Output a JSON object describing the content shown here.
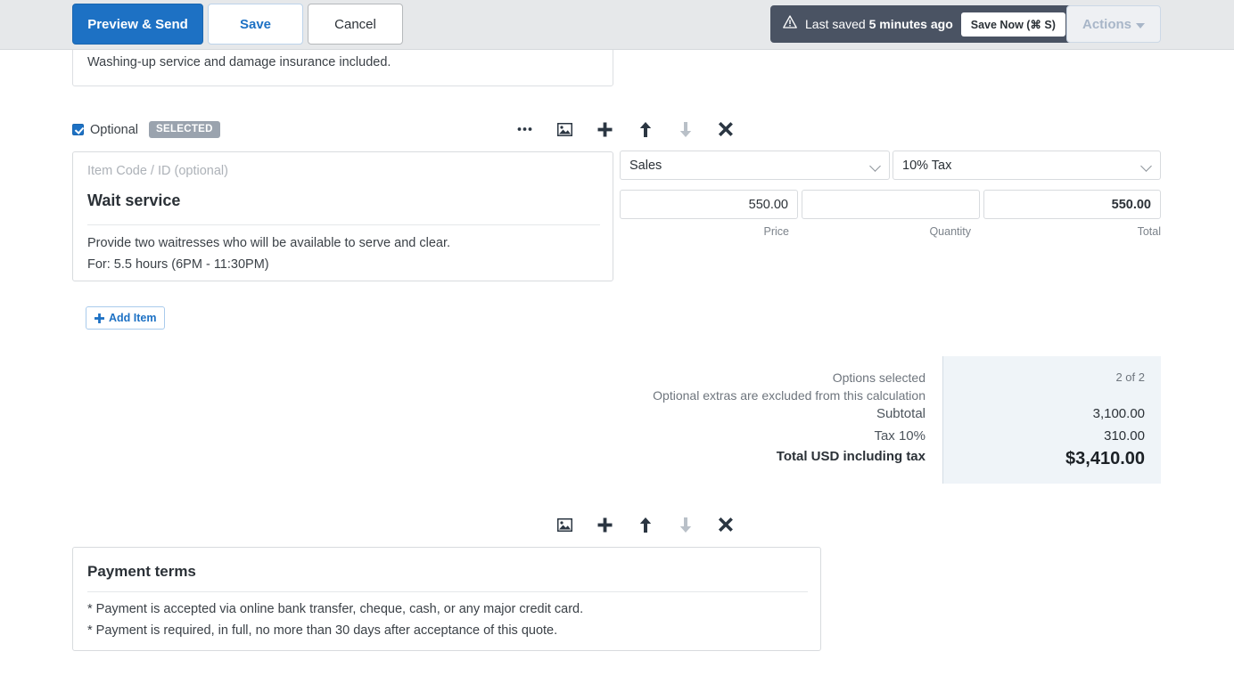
{
  "toolbar": {
    "preview_send_label": "Preview & Send",
    "save_label": "Save",
    "cancel_label": "Cancel",
    "saved_prefix": "Last saved ",
    "saved_time": "5 minutes ago",
    "save_now_label": "Save Now  (⌘ S)",
    "actions_label": "Actions",
    "accent_blue": "#1d71c4",
    "pill_bg": "#4a5363"
  },
  "clipped_text_box": {
    "text": "Washing-up service and damage insurance included."
  },
  "item": {
    "optional_label": "Optional",
    "optional_checked": true,
    "selected_badge": "SELECTED",
    "code_placeholder": "Item Code / ID (optional)",
    "title": "Wait service",
    "description_line1": "Provide two waitresses who will be available to serve and clear.",
    "description_line2": "For: 5.5 hours (6PM - 11:30PM)",
    "account": "Sales",
    "tax": "10% Tax",
    "price": "550.00",
    "quantity": "",
    "total": "550.00",
    "price_label": "Price",
    "quantity_label": "Quantity",
    "total_label": "Total",
    "toolbar_icons": [
      "ellipsis-icon",
      "image-icon",
      "plus-icon",
      "arrow-up-icon",
      "arrow-down-icon",
      "close-icon"
    ]
  },
  "add_item": {
    "label": "Add Item"
  },
  "totals": {
    "options_selected_label": "Options selected",
    "options_selected_value": "2 of 2",
    "note_label": "Optional extras are excluded from this calculation",
    "note_value": "",
    "subtotal_label": "Subtotal",
    "subtotal_value": "3,100.00",
    "tax_label": "Tax 10%",
    "tax_value": "310.00",
    "total_label": "Total USD including tax",
    "total_value": "$3,410.00",
    "panel_bg": "#eff4f8"
  },
  "payment_terms": {
    "toolbar_icons": [
      "image-icon",
      "plus-icon",
      "arrow-up-icon",
      "arrow-down-icon",
      "close-icon"
    ],
    "title": "Payment terms",
    "line1": "* Payment is accepted via online bank transfer, cheque, cash, or any major credit card.",
    "line2": "* Payment is required, in full, no more than 30 days after acceptance of this quote."
  }
}
